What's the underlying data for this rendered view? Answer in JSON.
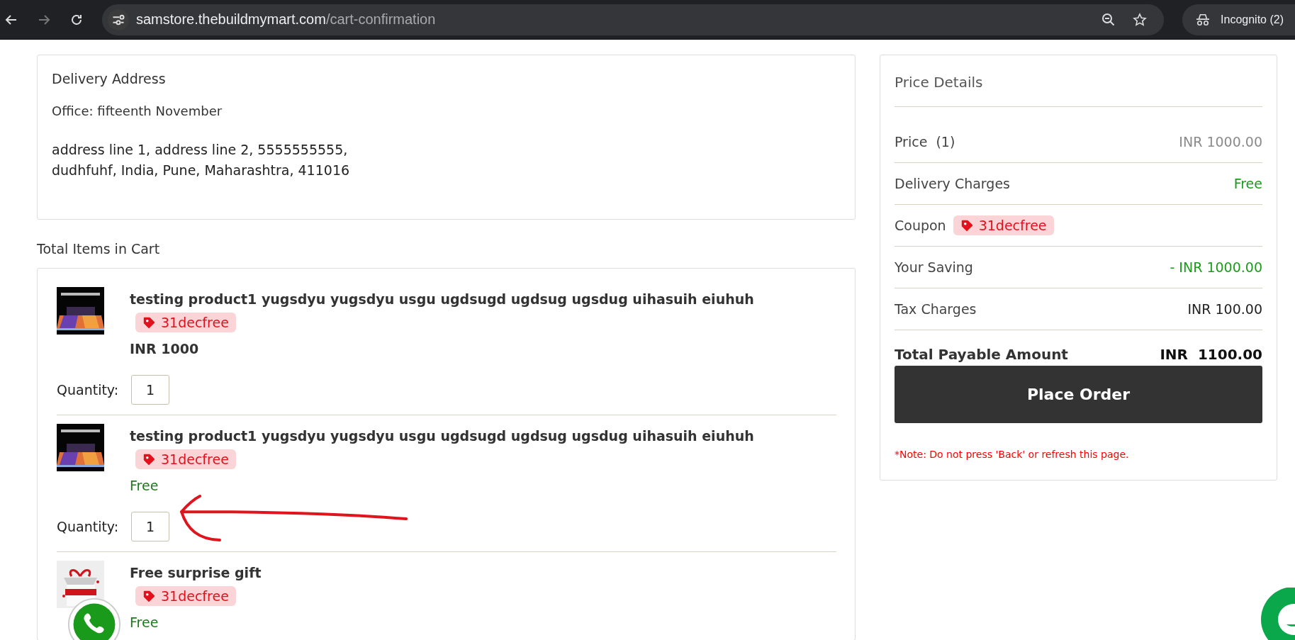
{
  "browser": {
    "url_host": "samstore.thebuildmymart.com",
    "url_path": "/cart-confirmation",
    "profile": "Incognito (2)"
  },
  "delivery": {
    "title": "Delivery Address",
    "label": "Office: fifteenth November",
    "address_lines": [
      "address line 1, address line 2, 5555555555,",
      "dudhfuhf, India, Pune, Maharashtra, 411016"
    ]
  },
  "cart": {
    "title": "Total Items in Cart",
    "items": [
      {
        "name": "testing product1 yugsdyu yugsdyu usgu ugdsugd ugdsug ugsdug uihasuih eiuhuh",
        "kind": "product",
        "coupon": "31decfree",
        "price": "INR 1000",
        "free": false,
        "quantity_label": "Quantity:",
        "quantity": "1"
      },
      {
        "name": "testing product1 yugsdyu yugsdyu usgu ugdsugd ugdsug ugsdug uihasuih eiuhuh",
        "kind": "product",
        "coupon": "31decfree",
        "price": "Free",
        "free": true,
        "quantity_label": "Quantity:",
        "quantity": "1"
      },
      {
        "name": "Free surprise gift",
        "kind": "gift",
        "coupon": "31decfree",
        "price": "Free",
        "free": true
      }
    ]
  },
  "price_details": {
    "title": "Price Details",
    "rows": [
      {
        "kind": "muted",
        "label": "Price",
        "count": "(1)",
        "value": "INR 1000.00"
      },
      {
        "kind": "discount",
        "label": "Delivery Charges",
        "value": "Free"
      },
      {
        "kind": "coupon",
        "label": "Coupon",
        "coupon": "31decfree"
      },
      {
        "kind": "discount",
        "label": "Your Saving",
        "value": "- INR 1000.00"
      },
      {
        "kind": "plain",
        "label": "Tax Charges",
        "value": "INR 100.00"
      }
    ],
    "total_label": "Total Payable Amount",
    "total_currency": "INR",
    "total_amount": "1100.00",
    "button": "Place Order",
    "note": "*Note: Do not press 'Back' or refresh this page."
  }
}
